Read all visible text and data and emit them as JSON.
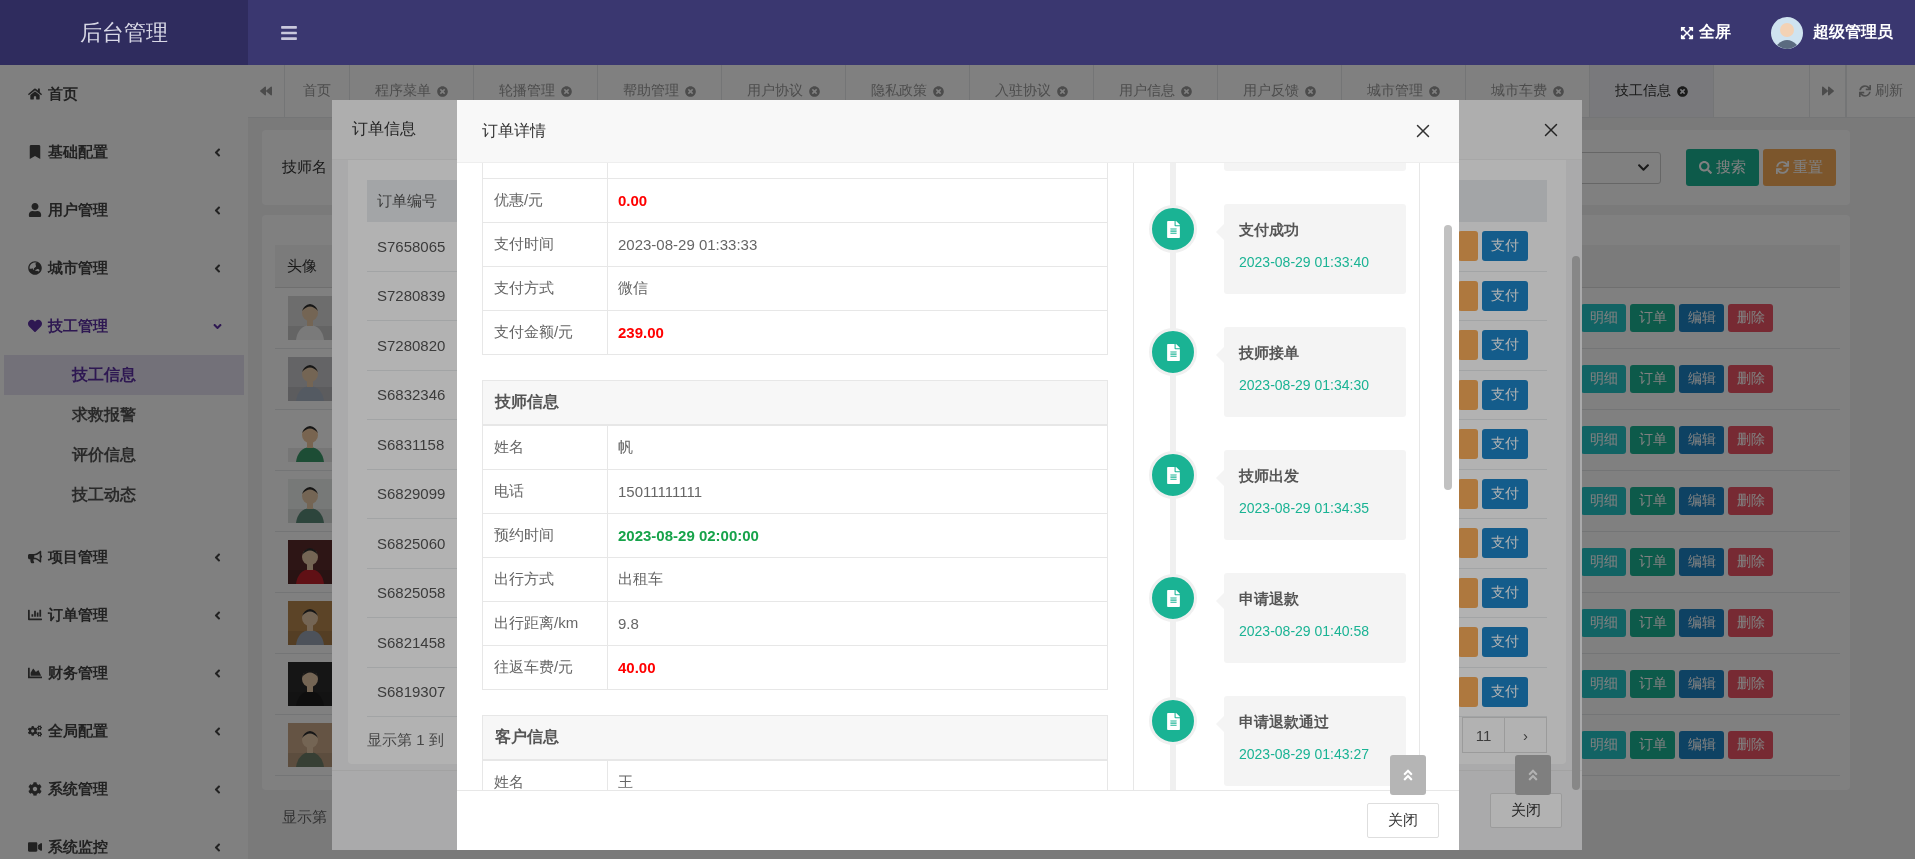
{
  "header": {
    "logo": "后台管理",
    "fullscreen": "全屏",
    "user": "超级管理员"
  },
  "sidebar": {
    "items": [
      {
        "label": "首页",
        "kind": "link"
      },
      {
        "label": "基础配置",
        "kind": "group",
        "expanded": false
      },
      {
        "label": "用户管理",
        "kind": "group",
        "expanded": false
      },
      {
        "label": "城市管理",
        "kind": "group",
        "expanded": false
      },
      {
        "label": "技工管理",
        "kind": "group",
        "expanded": true,
        "children": [
          {
            "label": "技工信息",
            "selected": true
          },
          {
            "label": "求救报警",
            "selected": false
          },
          {
            "label": "评价信息",
            "selected": false
          },
          {
            "label": "技工动态",
            "selected": false
          }
        ]
      },
      {
        "label": "项目管理",
        "kind": "group",
        "expanded": false
      },
      {
        "label": "订单管理",
        "kind": "group",
        "expanded": false
      },
      {
        "label": "财务管理",
        "kind": "group",
        "expanded": false
      },
      {
        "label": "全局配置",
        "kind": "group",
        "expanded": false
      },
      {
        "label": "系统管理",
        "kind": "group",
        "expanded": false
      },
      {
        "label": "系统监控",
        "kind": "group",
        "expanded": false
      }
    ]
  },
  "tabs": [
    {
      "label": "首页",
      "closable": false,
      "selected": false
    },
    {
      "label": "程序菜单",
      "closable": true,
      "selected": false
    },
    {
      "label": "轮播管理",
      "closable": true,
      "selected": false
    },
    {
      "label": "帮助管理",
      "closable": true,
      "selected": false
    },
    {
      "label": "用户协议",
      "closable": true,
      "selected": false
    },
    {
      "label": "隐私政策",
      "closable": true,
      "selected": false
    },
    {
      "label": "入驻协议",
      "closable": true,
      "selected": false
    },
    {
      "label": "用户信息",
      "closable": true,
      "selected": false
    },
    {
      "label": "用户反馈",
      "closable": true,
      "selected": false
    },
    {
      "label": "城市管理",
      "closable": true,
      "selected": false
    },
    {
      "label": "城市车费",
      "closable": true,
      "selected": false
    },
    {
      "label": "技工信息",
      "closable": true,
      "selected": true
    }
  ],
  "refresh": "刷新",
  "search": {
    "label": "技师名",
    "search_button": "搜索",
    "reset_button": "重置"
  },
  "table": {
    "columns": [
      "头像"
    ],
    "rows": [
      {
        "actions": [
          "明细",
          "订单",
          "编辑",
          "删除"
        ]
      },
      {
        "actions": [
          "明细",
          "订单",
          "编辑",
          "删除"
        ]
      },
      {
        "actions": [
          "明细",
          "订单",
          "编辑",
          "删除"
        ]
      },
      {
        "actions": [
          "明细",
          "订单",
          "编辑",
          "删除"
        ]
      },
      {
        "actions": [
          "明细",
          "订单",
          "编辑",
          "删除"
        ]
      },
      {
        "actions": [
          "明细",
          "订单",
          "编辑",
          "删除"
        ]
      },
      {
        "actions": [
          "明细",
          "订单",
          "编辑",
          "删除"
        ]
      },
      {
        "actions": [
          "明细",
          "订单",
          "编辑",
          "删除"
        ]
      }
    ]
  },
  "footer": "显示第",
  "order_modal": {
    "title": "订单信息",
    "columns": [
      "订单编号"
    ],
    "rows": [
      {
        "order_no": "S7658065",
        "pay_button": "支付"
      },
      {
        "order_no": "S7280839",
        "pay_button": "支付"
      },
      {
        "order_no": "S7280820",
        "pay_button": "支付"
      },
      {
        "order_no": "S6832346",
        "pay_button": "支付"
      },
      {
        "order_no": "S6831158",
        "pay_button": "支付"
      },
      {
        "order_no": "S6829099",
        "pay_button": "支付"
      },
      {
        "order_no": "S6825060",
        "pay_button": "支付"
      },
      {
        "order_no": "S6825058",
        "pay_button": "支付"
      },
      {
        "order_no": "S6821458",
        "pay_button": "支付"
      },
      {
        "order_no": "S6819307",
        "pay_button": "支付"
      }
    ],
    "summary": "显示第 1 到",
    "pages": [
      "11",
      "›"
    ],
    "close_button": "关闭"
  },
  "detail_modal": {
    "title": "订单详情",
    "sections": [
      {
        "rows": [
          {
            "label": "优惠/元",
            "value": "0.00",
            "kind": "money"
          },
          {
            "label": "支付时间",
            "value": "2023-08-29 01:33:33",
            "kind": "plain"
          },
          {
            "label": "支付方式",
            "value": "微信",
            "kind": "plain"
          },
          {
            "label": "支付金额/元",
            "value": "239.00",
            "kind": "money"
          }
        ]
      },
      {
        "title": "技师信息",
        "rows": [
          {
            "label": "姓名",
            "value": "帆",
            "kind": "plain"
          },
          {
            "label": "电话",
            "value": "15011111111",
            "kind": "plain"
          },
          {
            "label": "预约时间",
            "value": "2023-08-29 02:00:00",
            "kind": "highlight"
          },
          {
            "label": "出行方式",
            "value": "出租车",
            "kind": "plain"
          },
          {
            "label": "出行距离/km",
            "value": "9.8",
            "kind": "plain"
          },
          {
            "label": "往返车费/元",
            "value": "40.00",
            "kind": "money"
          }
        ]
      },
      {
        "title": "客户信息",
        "rows": [
          {
            "label": "姓名",
            "value": "王",
            "kind": "plain"
          }
        ]
      }
    ],
    "timeline": [
      {
        "title": "支付成功",
        "time": "2023-08-29 01:33:40"
      },
      {
        "title": "技师接单",
        "time": "2023-08-29 01:34:30"
      },
      {
        "title": "技师出发",
        "time": "2023-08-29 01:34:35"
      },
      {
        "title": "申请退款",
        "time": "2023-08-29 01:40:58"
      },
      {
        "title": "申请退款通过",
        "time": "2023-08-29 01:43:27"
      }
    ],
    "close_button": "关闭"
  }
}
